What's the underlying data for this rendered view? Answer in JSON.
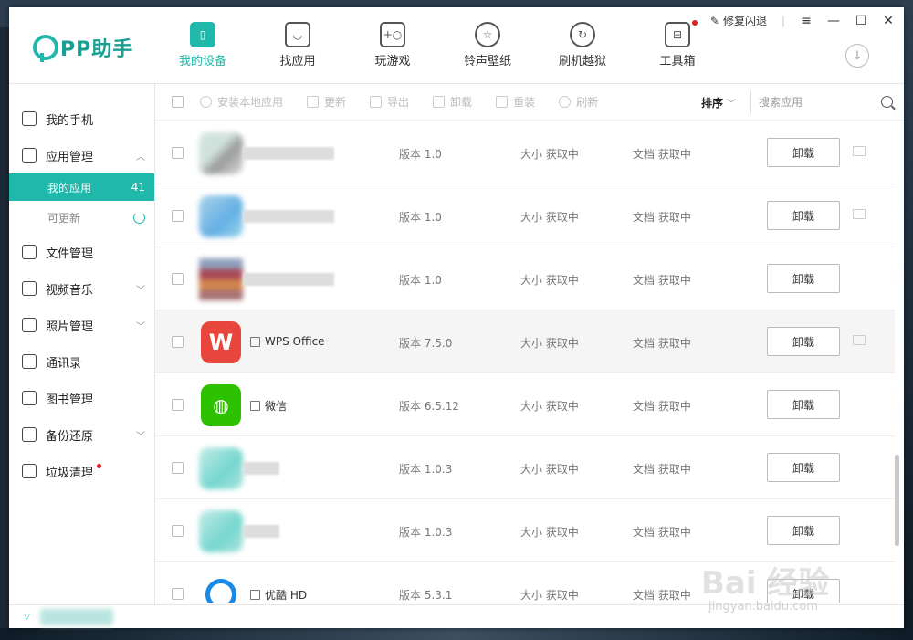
{
  "app": {
    "logo_text": "PP助手"
  },
  "window_controls": {
    "repair_label": "修复闪退"
  },
  "nav": [
    {
      "label": "我的设备",
      "active": true
    },
    {
      "label": "找应用",
      "active": false
    },
    {
      "label": "玩游戏",
      "active": false
    },
    {
      "label": "铃声壁纸",
      "active": false
    },
    {
      "label": "刷机越狱",
      "active": false
    },
    {
      "label": "工具箱",
      "active": false
    }
  ],
  "sidebar": {
    "items": [
      {
        "label": "我的手机",
        "icon": "phone-icon"
      },
      {
        "label": "应用管理",
        "icon": "bag-icon"
      },
      {
        "label": "文件管理",
        "icon": "folder-icon"
      },
      {
        "label": "视频音乐",
        "icon": "play-icon"
      },
      {
        "label": "照片管理",
        "icon": "photo-icon"
      },
      {
        "label": "通讯录",
        "icon": "contacts-icon"
      },
      {
        "label": "图书管理",
        "icon": "book-icon"
      },
      {
        "label": "备份还原",
        "icon": "backup-icon"
      },
      {
        "label": "垃圾清理",
        "icon": "clean-icon"
      }
    ],
    "sub_my_apps": "我的应用",
    "sub_my_apps_count": "41",
    "sub_updatable": "可更新"
  },
  "toolbar": {
    "install_local": "安装本地应用",
    "update": "更新",
    "export": "导出",
    "uninstall": "卸载",
    "reinstall": "重装",
    "refresh": "刷新",
    "sort": "排序",
    "search_placeholder": "搜索应用"
  },
  "apps": [
    {
      "name": "",
      "version": "版本 1.0",
      "size": "大小 获取中",
      "docs": "文档 获取中",
      "action": "卸载"
    },
    {
      "name": "",
      "version": "版本 1.0",
      "size": "大小 获取中",
      "docs": "文档 获取中",
      "action": "卸载"
    },
    {
      "name": "",
      "version": "版本 1.0",
      "size": "大小 获取中",
      "docs": "文档 获取中",
      "action": "卸载"
    },
    {
      "name": "WPS Office",
      "version": "版本 7.5.0",
      "size": "大小 获取中",
      "docs": "文档 获取中",
      "action": "卸载"
    },
    {
      "name": "微信",
      "version": "版本 6.5.12",
      "size": "大小 获取中",
      "docs": "文档 获取中",
      "action": "卸载"
    },
    {
      "name": "",
      "version": "版本 1.0.3",
      "size": "大小 获取中",
      "docs": "文档 获取中",
      "action": "卸载"
    },
    {
      "name": "",
      "version": "版本 1.0.3",
      "size": "大小 获取中",
      "docs": "文档 获取中",
      "action": "卸载"
    },
    {
      "name": "优酷 HD",
      "version": "版本 5.3.1",
      "size": "大小 获取中",
      "docs": "文档 获取中",
      "action": "卸载"
    }
  ],
  "watermark": {
    "text": "Bai 经验",
    "sub": "jingyan.baidu.com"
  },
  "colors": {
    "accent": "#1fb8aa",
    "notification_dot": "#e02020"
  }
}
